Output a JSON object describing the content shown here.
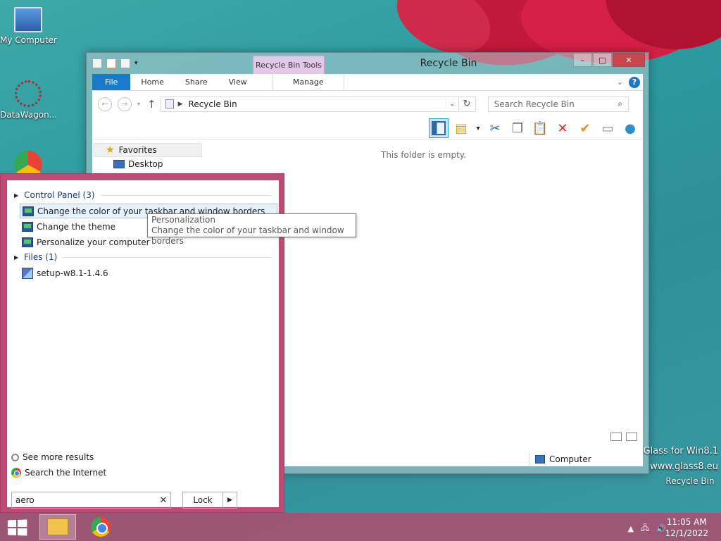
{
  "desktop": {
    "icons": [
      {
        "label": "My Computer",
        "icon": "computer-icon"
      },
      {
        "label": "DataWagon...",
        "icon": "datawagon-shortcut-icon"
      },
      {
        "label": "",
        "icon": "chrome-icon"
      }
    ],
    "recycle_bin_label": "Recycle Bin",
    "watermark_line1": "Glass for Win8.1",
    "watermark_line2": "www.glass8.eu"
  },
  "explorer": {
    "title": "Recycle Bin",
    "contextual_group": "Recycle Bin Tools",
    "tabs": [
      "File",
      "Home",
      "Share",
      "View"
    ],
    "contextual_tab": "Manage",
    "address": "Recycle Bin",
    "search_placeholder": "Search Recycle Bin",
    "empty_message": "This folder is empty.",
    "nav": {
      "favorites": "Favorites",
      "desktop": "Desktop"
    },
    "status_location": "Computer",
    "window_buttons": {
      "minimize": "–",
      "maximize": "□",
      "close": "✕"
    }
  },
  "start_search": {
    "groups": [
      {
        "label": "Control Panel (3)"
      },
      {
        "label": "Files (1)"
      }
    ],
    "control_panel_results": [
      "Change the color of your taskbar and window borders",
      "Change the theme",
      "Personalize your computer"
    ],
    "file_results": [
      "setup-w8.1-1.4.6"
    ],
    "tooltip_line1": "Personalization",
    "tooltip_line2": "Change the color of your taskbar and window borders",
    "see_more": "See more results",
    "search_internet": "Search the Internet",
    "query": "aero",
    "clear": "✕",
    "power_button": "Lock"
  },
  "taskbar": {
    "time": "11:05 AM",
    "date": "12/1/2022"
  },
  "colors": {
    "accent": "#c04a76",
    "file_tab": "#1979ca",
    "contextual_tab": "#e3c8ea"
  }
}
